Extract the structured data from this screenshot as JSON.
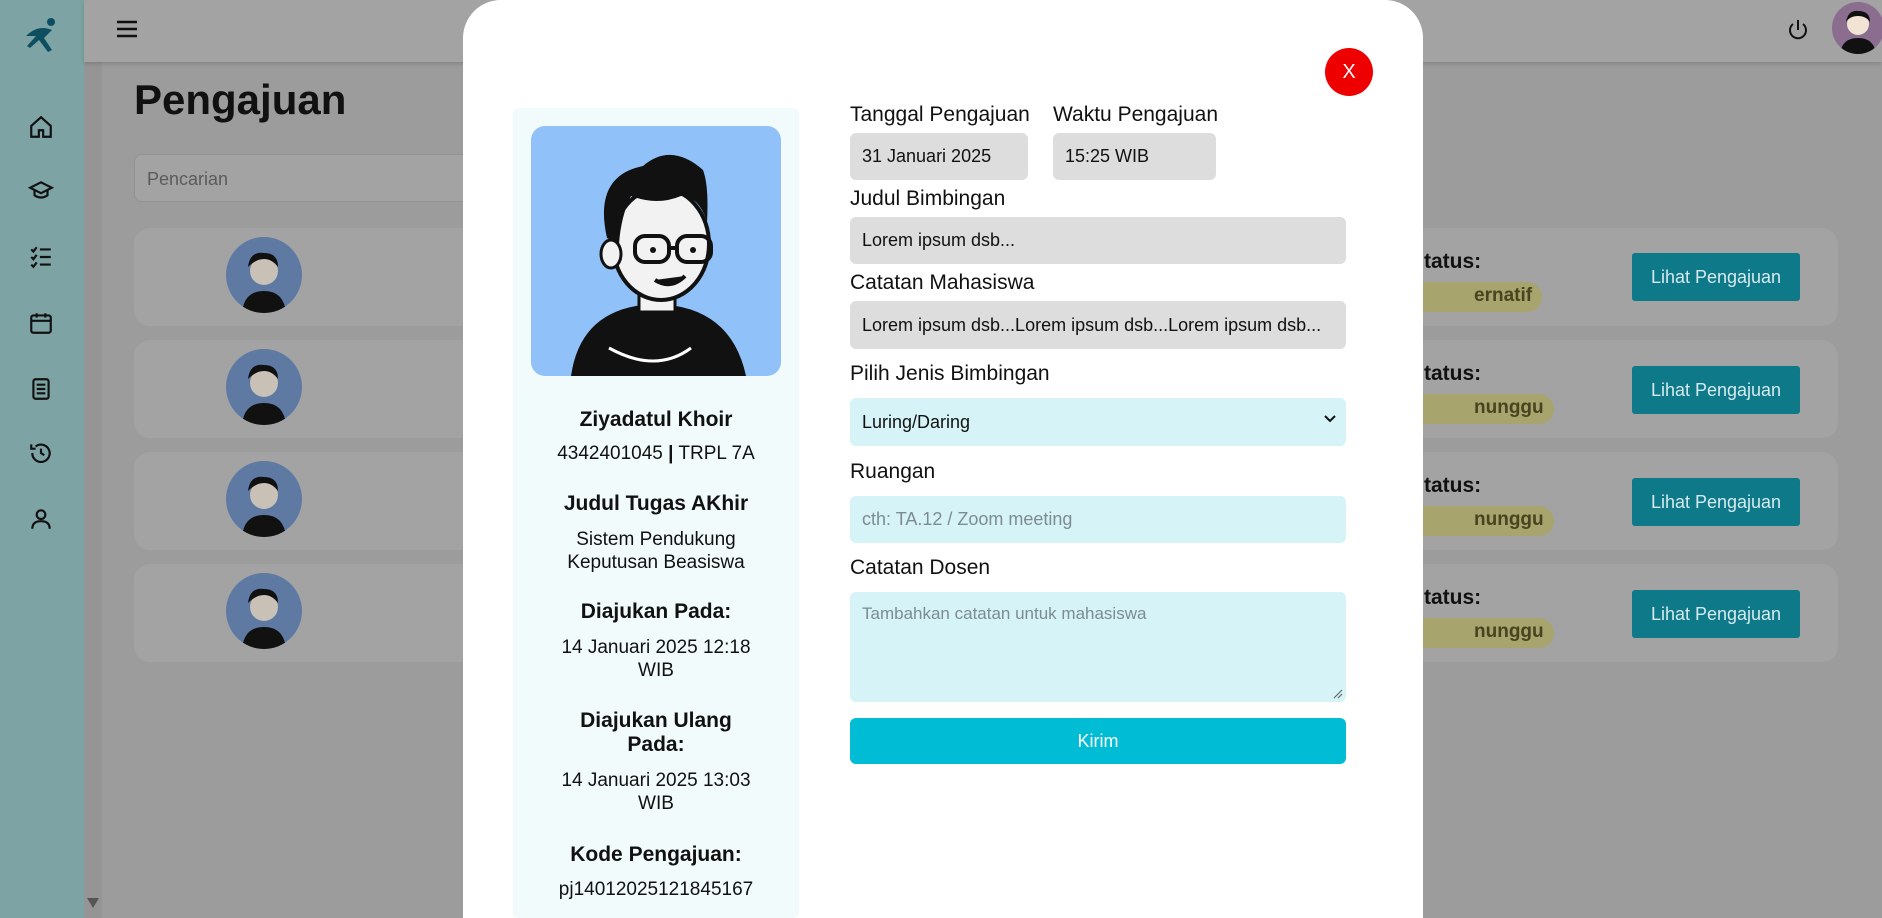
{
  "header": {
    "page_title": "Pengajuan",
    "search_placeholder": "Pencarian"
  },
  "sidebar": {
    "icons": [
      "home-icon",
      "graduation-cap-icon",
      "checklist-icon",
      "calendar-icon",
      "document-icon",
      "history-icon",
      "user-icon"
    ]
  },
  "list": {
    "rows": [
      {
        "status_label": "tatus:",
        "status_value": "ernatif",
        "button_label": "Lihat Pengajuan"
      },
      {
        "status_label": "tatus:",
        "status_value": "nunggu",
        "button_label": "Lihat Pengajuan"
      },
      {
        "status_label": "tatus:",
        "status_value": "nunggu",
        "button_label": "Lihat Pengajuan"
      },
      {
        "status_label": "tatus:",
        "status_value": "nunggu",
        "button_label": "Lihat Pengajuan"
      }
    ]
  },
  "modal": {
    "close_label": "X",
    "profile": {
      "name": "Ziyadatul Khoir",
      "nim": "4342401045",
      "separator": "|",
      "class": "TRPL 7A",
      "thesis_heading": "Judul Tugas AKhir",
      "thesis_line1": "Sistem Pendukung",
      "thesis_line2": "Keputusan Beasiswa",
      "submitted_heading": "Diajukan Pada:",
      "submitted_line1": "14 Januari 2025 12:18",
      "submitted_line2": "WIB",
      "resubmitted_heading_line1": "Diajukan Ulang",
      "resubmitted_heading_line2": "Pada:",
      "resubmitted_line1": "14 Januari 2025 13:03",
      "resubmitted_line2": "WIB",
      "code_heading": "Kode Pengajuan:",
      "code_value": "pj14012025121845167"
    },
    "form": {
      "date_label": "Tanggal Pengajuan",
      "date_value": "31 Januari 2025",
      "time_label": "Waktu Pengajuan",
      "time_value": "15:25 WIB",
      "title_label": "Judul Bimbingan",
      "title_value": "Lorem ipsum dsb...",
      "student_note_label": "Catatan Mahasiswa",
      "student_note_value": "Lorem ipsum dsb...Lorem ipsum dsb...Lorem ipsum dsb...",
      "type_label": "Pilih Jenis Bimbingan",
      "type_value": "Luring/Daring",
      "room_label": "Ruangan",
      "room_placeholder": "cth: TA.12 / Zoom meeting",
      "lecturer_note_label": "Catatan Dosen",
      "lecturer_note_placeholder": "Tambahkan catatan untuk mahasiswa",
      "submit_label": "Kirim"
    }
  },
  "colors": {
    "accent": "#00bcd4",
    "close": "#ee0000",
    "profile_bg": "#90c1f8",
    "badge": "#e8e15a"
  }
}
